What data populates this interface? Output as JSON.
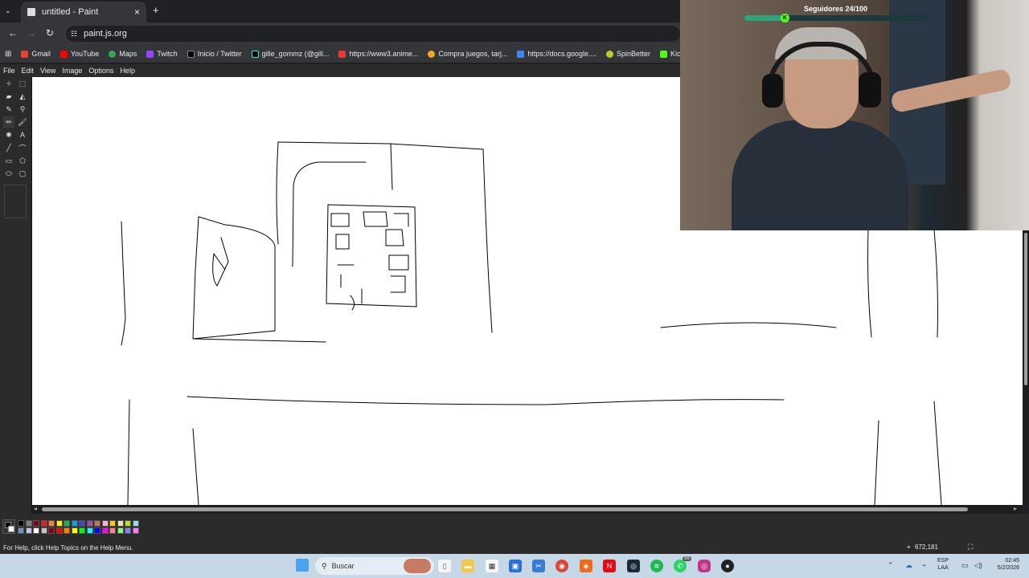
{
  "browser": {
    "tab_title": "untitled - Paint",
    "tab_close": "×",
    "new_tab": "+",
    "url": "paint.js.org",
    "bookmarks": [
      {
        "label": "Gmail",
        "icon": "gmail-icon",
        "color": "#ea4335"
      },
      {
        "label": "YouTube",
        "icon": "youtube-icon",
        "color": "#ff0000"
      },
      {
        "label": "Maps",
        "icon": "maps-icon",
        "color": "#34a853"
      },
      {
        "label": "Twitch",
        "icon": "twitch-icon",
        "color": "#9146ff"
      },
      {
        "label": "Inicio / Twitter",
        "icon": "x-icon",
        "color": "#000000"
      },
      {
        "label": "gille_gommz (@gill...",
        "icon": "tiktok-icon",
        "color": "#000000"
      },
      {
        "label": "https://www3.anime...",
        "icon": "anime-icon",
        "color": "#e53935"
      },
      {
        "label": "Compra juegos, tarj...",
        "icon": "store-icon",
        "color": "#f9a825"
      },
      {
        "label": "https://docs.google....",
        "icon": "docs-icon",
        "color": "#4285f4"
      },
      {
        "label": "SpinBetter",
        "icon": "spinbetter-icon",
        "color": "#c0ca33"
      },
      {
        "label": "Kick",
        "icon": "kick-icon",
        "color": "#53fc18"
      }
    ]
  },
  "paint": {
    "menu": [
      "File",
      "Edit",
      "View",
      "Image",
      "Options",
      "Help"
    ],
    "status_help": "For Help, click Help Topics on the Help Menu.",
    "cursor_coords": "672,181",
    "palette_colors": [
      "#000000",
      "#7f7f7f",
      "#880015",
      "#ed1c24",
      "#ff7f27",
      "#fff200",
      "#22b14c",
      "#00a2e8",
      "#3f48cc",
      "#a349a4",
      "#b97a57",
      "#ffaec9",
      "#ffc90e",
      "#efe4b0",
      "#b5e61d",
      "#99d9ea",
      "#7092be",
      "#c8bfe7",
      "#ffffff",
      "#c3c3c3",
      "#880015",
      "#ff0000",
      "#ff8000",
      "#ffff00",
      "#00ff00",
      "#00ffff",
      "#0000ff",
      "#ff00ff",
      "#ff8080",
      "#80ff80",
      "#8080ff",
      "#ff80ff"
    ]
  },
  "stream_overlay": {
    "followers_label": "Seguidores 24/100",
    "followers_progress": 0.24
  },
  "taskbar": {
    "search_placeholder": "Buscar",
    "lang_line1": "ESP",
    "lang_line2": "LAA",
    "time": "02:45",
    "date": "5/2/2026",
    "spotify_badge": "99"
  }
}
